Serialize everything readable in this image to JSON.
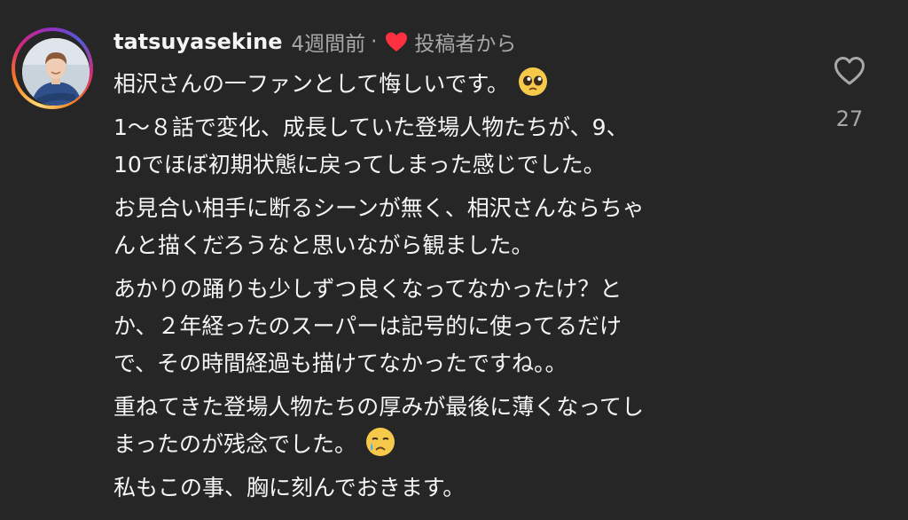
{
  "comment": {
    "username": "tatsuyasekine",
    "time": "4週間前",
    "separator": "·",
    "liked_by_author_label": "投稿者から",
    "avatar_icon": "user-avatar",
    "heart_color": "#ff3040",
    "paragraphs": [
      {
        "lines": [
          "相沢さんの一ファンとして悔しいです。"
        ],
        "emoji": "pleading-face-emoji"
      },
      {
        "lines": [
          "1〜８話で変化、成長していた登場人物たちが、9、",
          "10でほぼ初期状態に戻ってしまった感じでした。"
        ]
      },
      {
        "lines": [
          "お見合い相手に断るシーンが無く、相沢さんならちゃ",
          "んと描くだろうなと思いながら観ました。"
        ]
      },
      {
        "lines": [
          "あかりの踊りも少しずつ良くなってなかったけ？と",
          "か、２年経ったのスーパーは記号的に使ってるだけ",
          "で、その時間経過も描けてなかったですね。。"
        ]
      },
      {
        "lines": [
          "重ねてきた登場人物たちの厚みが最後に薄くなってし",
          "まったのが残念でした。"
        ],
        "emoji": "crying-face-emoji"
      },
      {
        "lines": [
          "私もこの事、胸に刻んでおきます。"
        ]
      }
    ]
  },
  "like": {
    "icon": "heart-outline-icon",
    "count": "27"
  }
}
